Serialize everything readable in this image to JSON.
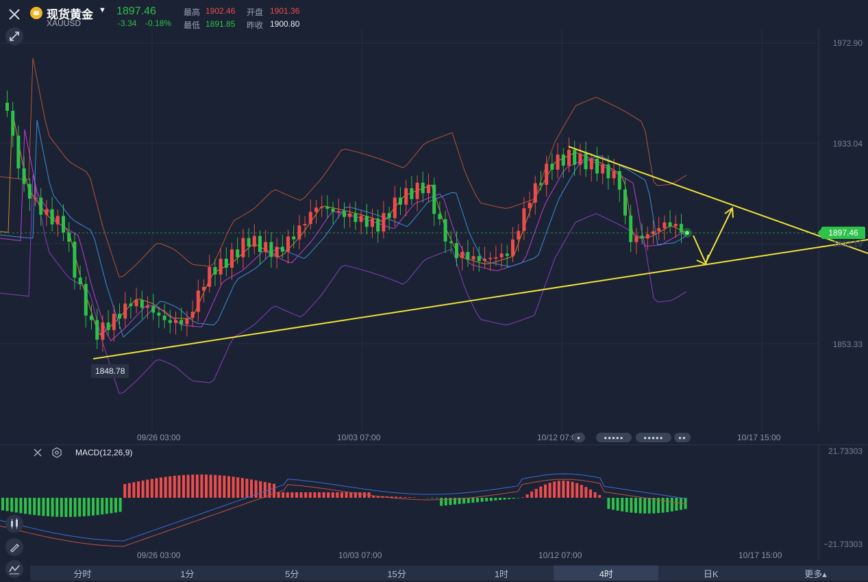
{
  "header": {
    "title": "现货黄金",
    "code": "XAUUSD",
    "price": "1897.46",
    "change": "-3.34",
    "change_pct": "-0.18%",
    "high_label": "最高",
    "high": "1902.46",
    "open_label": "开盘",
    "open": "1901.36",
    "low_label": "最低",
    "low": "1891.85",
    "prev_label": "昨收",
    "prev": "1900.80"
  },
  "price_axis": {
    "top": "1972.90",
    "mid": "1933.04",
    "bottom": "1853.33",
    "hidden": "1893.19",
    "current": "1897.46"
  },
  "low_marker": "1848.78",
  "time_axis": [
    "09/26 03:00",
    "10/03 07:00",
    "10/12 07:00",
    "10/17 15:00"
  ],
  "macd": {
    "label": "MACD(12,26,9)",
    "top": "21.73303",
    "bottom": "−21.73303",
    "time_axis": [
      "09/26 03:00",
      "10/03 07:00",
      "10/12 07:00",
      "10/17 15:00"
    ]
  },
  "tabs": [
    "分时",
    "1分",
    "5分",
    "15分",
    "1时",
    "4时",
    "日K",
    "更多▴"
  ],
  "active_tab": "4时",
  "colors": {
    "up": "#ef4c4c",
    "down": "#2ec24a",
    "trendline": "#f0e23c",
    "background": "#1b2233"
  },
  "icons": [
    "close-icon",
    "expand-icon",
    "settings-icon",
    "candle-type-icon",
    "pen-icon",
    "indicator-icon"
  ]
}
